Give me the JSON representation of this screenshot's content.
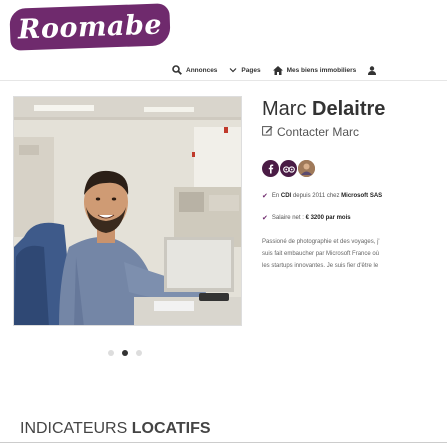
{
  "brand": {
    "logo_text": "Roomabe",
    "accent": "#6f2a6d"
  },
  "nav": {
    "items": [
      {
        "label": "Annonces",
        "icon": "search-icon"
      },
      {
        "label": "Pages",
        "icon": "chevron-down-icon"
      },
      {
        "label": "Mes biens immobiliers",
        "icon": "home-icon"
      },
      {
        "label": "",
        "icon": "user-icon"
      }
    ]
  },
  "profile": {
    "first_name": "Marc",
    "last_name": "Delaitre",
    "contact_label": "Contacter Marc",
    "socials": [
      "facebook-icon",
      "tripadvisor-icon",
      "profile-photo-icon"
    ],
    "contract_prefix": "En ",
    "contract_type": "CDI",
    "contract_mid": " depuis 2011 chez ",
    "employer": "Microsoft SAS",
    "salary_prefix": "Salaire net : ",
    "salary_value": "€ 3200 par mois",
    "description_lines": [
      "Passioné de photographie et des voyages, j'",
      "suis fait embaucher par Microsoft France où",
      "les startups innovantes. Je suis fier d'être le"
    ]
  },
  "carousel": {
    "count": 3,
    "active_index": 1
  },
  "section": {
    "title_regular": "INDICATEURS ",
    "title_bold": "LOCATIFS"
  }
}
